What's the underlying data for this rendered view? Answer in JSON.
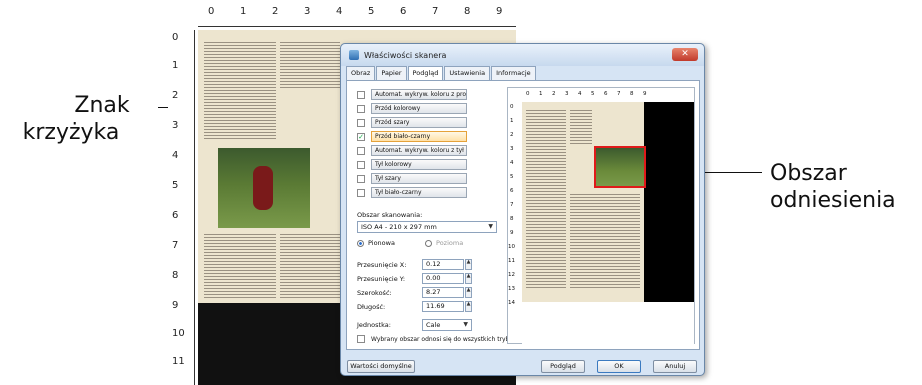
{
  "annotations": {
    "crosshair_label_line1": "Znak",
    "crosshair_label_line2": "krzyżyka",
    "reference_label_line1": "Obszar",
    "reference_label_line2": "odniesienia"
  },
  "background_ruler": {
    "top": [
      "0",
      "1",
      "2",
      "3",
      "4",
      "5",
      "6",
      "7",
      "8",
      "9"
    ],
    "left": [
      "0",
      "1",
      "2",
      "3",
      "4",
      "5",
      "6",
      "7",
      "8",
      "9",
      "10",
      "11"
    ]
  },
  "dialog": {
    "title": "Właściwości skanera",
    "tabs": [
      "Obraz",
      "Papier",
      "Podgląd",
      "Ustawienia",
      "Informacje"
    ],
    "active_tab": "Podgląd",
    "image_options": [
      {
        "label": "Automat. wykryw. koloru z pro",
        "checked": false
      },
      {
        "label": "Przód kolorowy",
        "checked": false
      },
      {
        "label": "Przód szary",
        "checked": false
      },
      {
        "label": "Przód biało-czarny",
        "checked": true
      },
      {
        "label": "Automat. wykryw. koloru z tył",
        "checked": false
      },
      {
        "label": "Tył kolorowy",
        "checked": false
      },
      {
        "label": "Tył szary",
        "checked": false
      },
      {
        "label": "Tył biało-czarny",
        "checked": false
      }
    ],
    "scan_area_label": "Obszar skanowania:",
    "scan_area_value": "ISO A4 - 210 x 297 mm",
    "orientation": {
      "portrait": "Pionowa",
      "landscape": "Pozioma"
    },
    "fields": [
      {
        "label": "Przesunięcie X:",
        "value": "0.12"
      },
      {
        "label": "Przesunięcie Y:",
        "value": "0.00"
      },
      {
        "label": "Szerokość:",
        "value": "8.27"
      },
      {
        "label": "Długość:",
        "value": "11.69"
      }
    ],
    "unit_label": "Jednostka:",
    "unit_value": "Cale",
    "apply_all_label": "Wybrany obszar odnosi się do wszystkich trybów",
    "preview_ruler": {
      "top": [
        "0",
        "1",
        "2",
        "3",
        "4",
        "5",
        "6",
        "7",
        "8",
        "9"
      ],
      "left": [
        "0",
        "1",
        "2",
        "3",
        "4",
        "5",
        "6",
        "7",
        "8",
        "9",
        "10",
        "11",
        "12",
        "13",
        "14"
      ]
    },
    "buttons": {
      "defaults": "Wartości domyślne",
      "preview": "Podgląd",
      "ok": "OK",
      "cancel": "Anuluj"
    }
  }
}
